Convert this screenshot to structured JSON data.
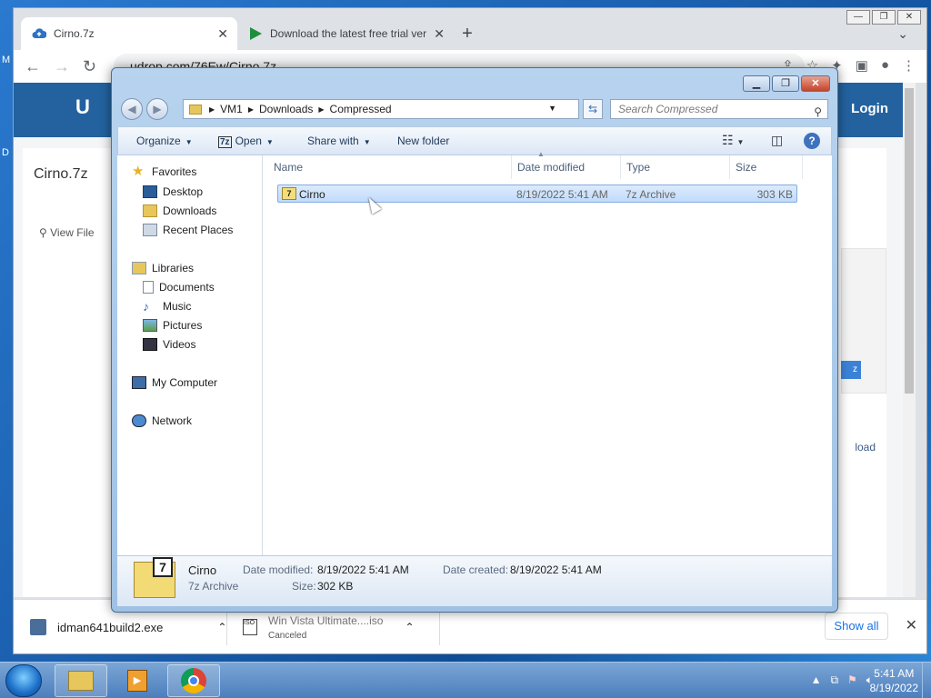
{
  "desktop": {
    "fragments": [
      "M",
      "D"
    ]
  },
  "browser": {
    "tabs": [
      {
        "title": "Cirno.7z",
        "active": true
      },
      {
        "title": "Download the latest free trial ver",
        "active": false
      }
    ],
    "new_tab": "+",
    "address": "udrop.com/76Ew/Cirno.7z",
    "page": {
      "site_logo": "U",
      "login": "Login",
      "file_name": "Cirno.7z",
      "view_file": "View File",
      "side_button": "z",
      "side_text": "load"
    },
    "downloads": [
      {
        "name": "idman641build2.exe",
        "status": ""
      },
      {
        "name": "Win Vista Ultimate....iso",
        "status": "Canceled"
      }
    ],
    "show_all": "Show all"
  },
  "explorer": {
    "breadcrumbs": [
      "VM1",
      "Downloads",
      "Compressed"
    ],
    "search_placeholder": "Search Compressed",
    "commands": {
      "organize": "Organize",
      "open": "Open",
      "share_with": "Share with",
      "new_folder": "New folder"
    },
    "nav": {
      "favorites": {
        "label": "Favorites",
        "items": [
          "Desktop",
          "Downloads",
          "Recent Places"
        ]
      },
      "libraries": {
        "label": "Libraries",
        "items": [
          "Documents",
          "Music",
          "Pictures",
          "Videos"
        ]
      },
      "my_computer": "My Computer",
      "network": "Network"
    },
    "columns": [
      "Name",
      "Date modified",
      "Type",
      "Size"
    ],
    "files": [
      {
        "name": "Cirno",
        "date": "8/19/2022 5:41 AM",
        "type": "7z Archive",
        "size": "303 KB"
      }
    ],
    "details": {
      "name": "Cirno",
      "type": "7z Archive",
      "modified_label": "Date modified:",
      "modified": "8/19/2022 5:41 AM",
      "created_label": "Date created:",
      "created": "8/19/2022 5:41 AM",
      "size_label": "Size:",
      "size": "302 KB"
    }
  },
  "taskbar": {
    "time": "5:41 AM",
    "date": "8/19/2022"
  }
}
